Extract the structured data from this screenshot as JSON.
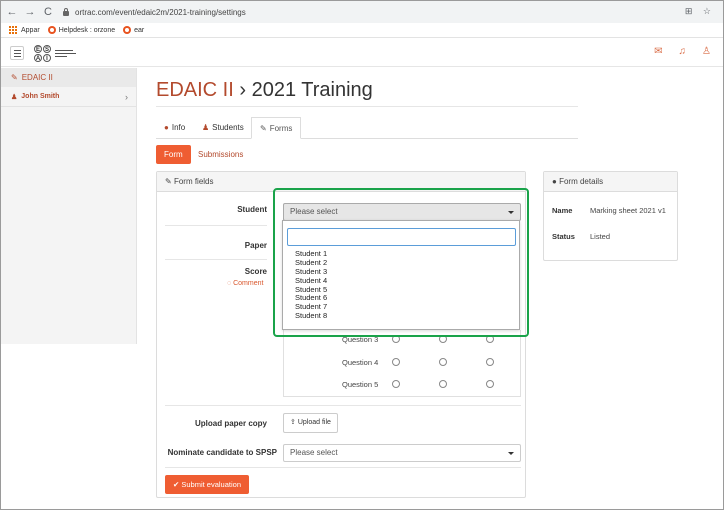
{
  "browser": {
    "url": "ortrac.com/event/edaic2m/2021-training/settings",
    "bookmarks": [
      "Appar",
      "Helpdesk : orzone",
      "ear"
    ]
  },
  "sidebar": {
    "top_label": "EDAIC II",
    "user_label": "John Smith"
  },
  "page": {
    "title_crumb": "EDAIC II",
    "title_sep": " › ",
    "title_main": "2021 Training"
  },
  "tabs": [
    {
      "label": "Info",
      "icon": "info-icon"
    },
    {
      "label": "Students",
      "icon": "users-icon"
    },
    {
      "label": "Forms",
      "icon": "edit-icon",
      "active": true
    }
  ],
  "pills": {
    "form": "Form",
    "submissions": "Submissions"
  },
  "form_panel": {
    "heading": "Form fields",
    "student_label": "Student",
    "student_placeholder": "Please select",
    "paper_label": "Paper",
    "score_label": "Score",
    "comment_link": "Comment",
    "questions": [
      "Question 3",
      "Question 4",
      "Question 5"
    ],
    "upload_label": "Upload paper copy",
    "upload_button": "Upload file",
    "nominate_label": "Nominate candidate to SPSP",
    "nominate_placeholder": "Please select",
    "submit_button": "Submit evaluation"
  },
  "dropdown": {
    "search_value": "",
    "options": [
      "Student 1",
      "Student 2",
      "Student 3",
      "Student 4",
      "Student 5",
      "Student 6",
      "Student 7",
      "Student 8"
    ]
  },
  "details_panel": {
    "heading": "Form details",
    "name_key": "Name",
    "name_value": "Marking sheet 2021 v1",
    "status_key": "Status",
    "status_value": "Listed"
  },
  "colors": {
    "accent": "#ef5d32",
    "brand_text": "#b34a2d",
    "highlight": "#1aa34a"
  }
}
